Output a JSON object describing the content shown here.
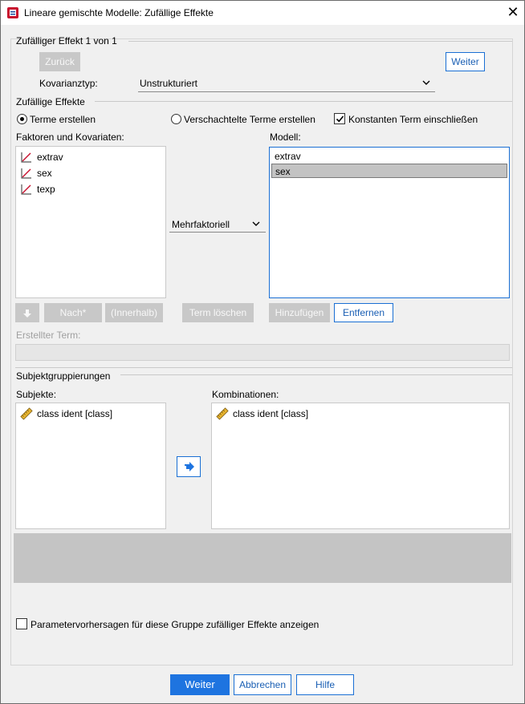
{
  "window": {
    "title": "Lineare gemischte Modelle: Zufällige Effekte",
    "close_glyph": "✕"
  },
  "random_effect": {
    "header": "Zufälliger Effekt 1 von 1",
    "back_label": "Zurück",
    "next_label": "Weiter",
    "covariance_label": "Kovarianztyp:",
    "covariance_value": "Unstrukturiert"
  },
  "random_effects": {
    "section_label": "Zufällige Effekte",
    "build_terms_label": "Terme erstellen",
    "nested_terms_label": "Verschachtelte Terme erstellen",
    "include_intercept_label": "Konstanten Term einschließen",
    "factors_label": "Faktoren und Kovariaten:",
    "factors": [
      {
        "label": "extrav",
        "icon": "scale-measure-icon"
      },
      {
        "label": "sex",
        "icon": "scale-measure-icon"
      },
      {
        "label": "texp",
        "icon": "scale-measure-icon"
      }
    ],
    "build_type": "Mehrfaktoriell",
    "model_label": "Modell:",
    "model_items": [
      "extrav",
      "sex"
    ],
    "model_selected_index": 1,
    "move_down_button_icon": "arrow-down-icon",
    "by_label": "Nach*",
    "within_label": "(Innerhalb)",
    "clear_term_label": "Term löschen",
    "add_label": "Hinzufügen",
    "remove_label": "Entfernen",
    "built_term_label": "Erstellter Term:",
    "built_term_value": ""
  },
  "subject_groupings": {
    "section_label": "Subjektgruppierungen",
    "subjects_label": "Subjekte:",
    "subjects": [
      {
        "label": "class ident [class]",
        "icon": "ruler-icon"
      }
    ],
    "combinations_label": "Kombinationen:",
    "combinations": [
      {
        "label": "class ident [class]",
        "icon": "ruler-icon"
      }
    ],
    "move_icon": "arrow-right-icon"
  },
  "predictions_label": "Parametervorhersagen für diese Gruppe zufälliger Effekte anzeigen",
  "footer": {
    "continue_label": "Weiter",
    "cancel_label": "Abbrechen",
    "help_label": "Hilfe"
  },
  "colors": {
    "accent": "#1e74e0",
    "selection": "#c3c3c3",
    "disabled_button": "#c8c8c8"
  }
}
